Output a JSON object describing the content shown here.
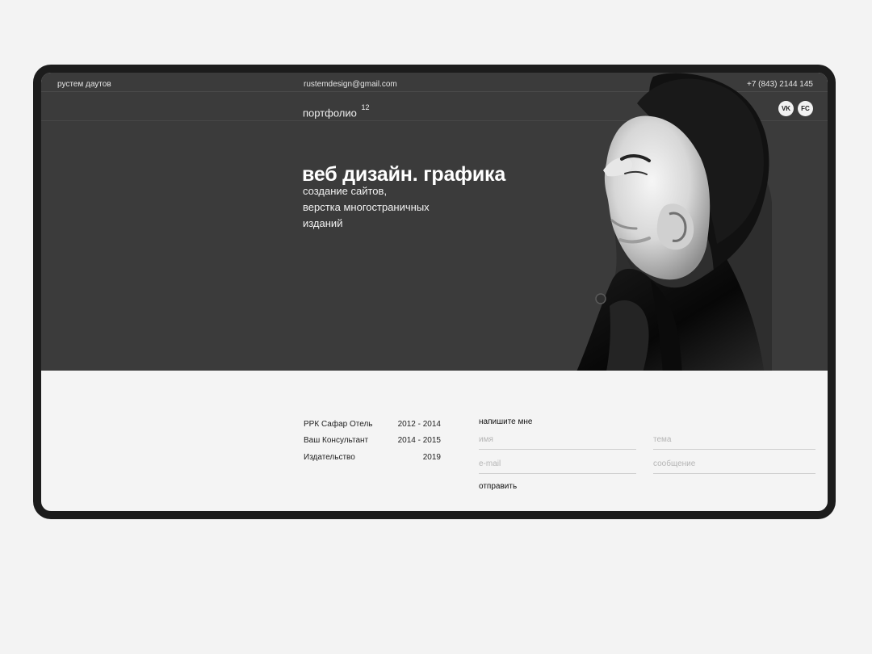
{
  "header": {
    "name": "рустем даутов",
    "email": "rustemdesign@gmail.com",
    "phone": "+7 (843) 2144 145"
  },
  "nav": {
    "portfolio_label": "портфолио",
    "portfolio_count": "12",
    "social": {
      "vk": "VK",
      "fc": "FC"
    }
  },
  "hero": {
    "headline": "веб дизайн. графика",
    "subtitle": [
      "создание сайтов,",
      "верстка многостраничных",
      "изданий"
    ]
  },
  "experience": [
    {
      "company": "РРК Сафар Отель",
      "years": "2012 - 2014"
    },
    {
      "company": "Ваш Консультант",
      "years": "2014 - 2015"
    },
    {
      "company": "Издательство",
      "years": "2019"
    }
  ],
  "contact": {
    "title": "напишите мне",
    "fields": {
      "name_placeholder": "имя",
      "theme_placeholder": "тема",
      "email_placeholder": "e-mail",
      "message_placeholder": "сообщение"
    },
    "send_label": "отправить"
  },
  "colors": {
    "page_bg": "#f3f3f3",
    "device_frame": "#1c1c1c",
    "hero_bg": "#3b3b3b",
    "footer_bg": "#f4f4f4",
    "accent_text": "#ffffff"
  },
  "icons": {
    "portrait": "portrait-photo",
    "vk": "vk-icon",
    "fc": "facebook-icon"
  }
}
